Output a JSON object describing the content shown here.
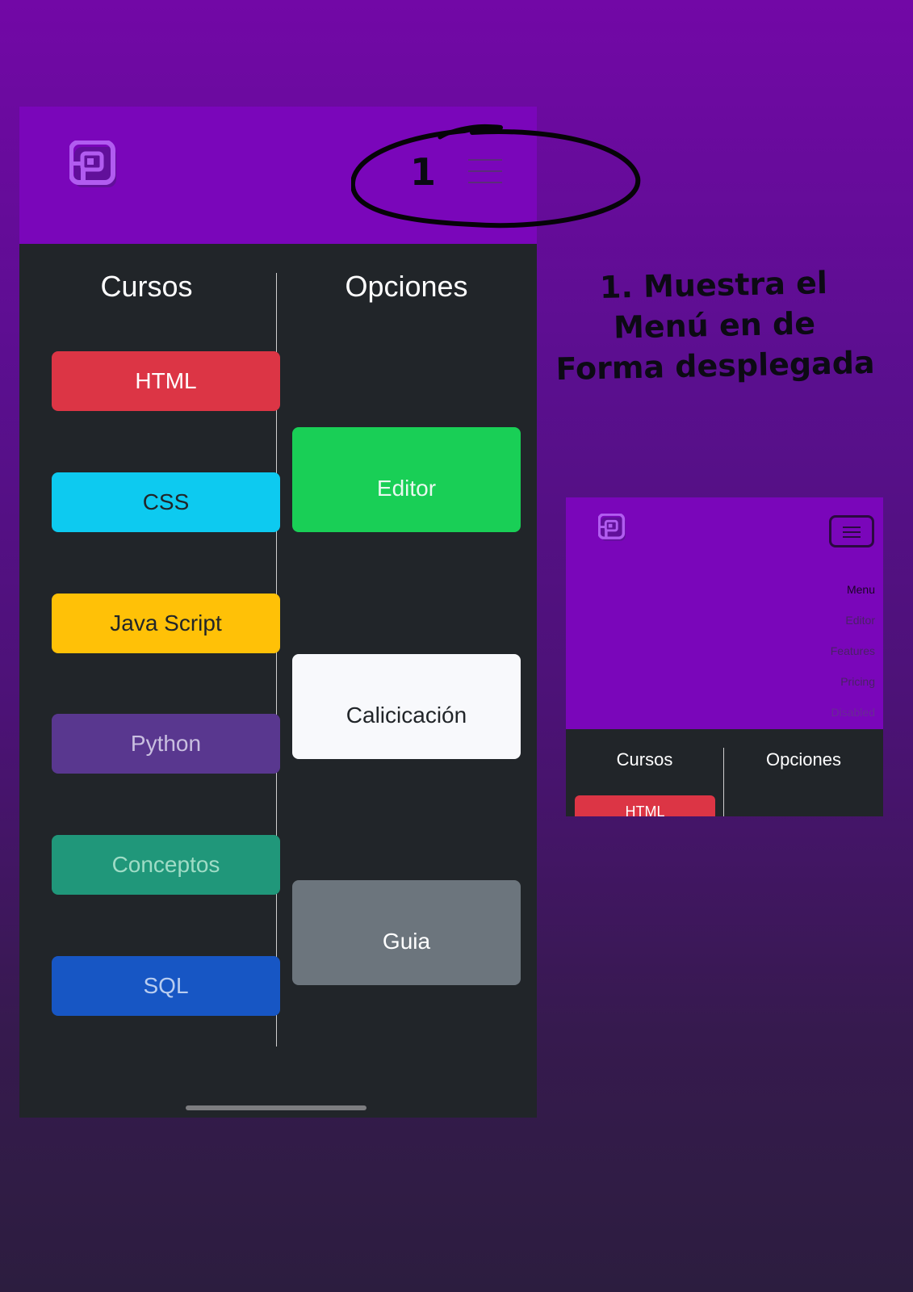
{
  "header": {
    "step_number": "1"
  },
  "main": {
    "courses_title": "Cursos",
    "options_title": "Opciones",
    "courses": [
      {
        "label": "HTML",
        "bg": "#dc3545",
        "fg": "#ffffff"
      },
      {
        "label": "CSS",
        "bg": "#0dcaf0",
        "fg": "#212529"
      },
      {
        "label": "Java Script",
        "bg": "#ffc107",
        "fg": "#212529"
      },
      {
        "label": "Python",
        "bg": "#59378f",
        "fg": "#c9bfe0"
      },
      {
        "label": "Conceptos",
        "bg": "#20977a",
        "fg": "#9fdcc6"
      },
      {
        "label": "SQL",
        "bg": "#1756c4",
        "fg": "#b9cdf0"
      }
    ],
    "options": [
      {
        "label": "Editor",
        "bg": "#19cf56",
        "fg": "#e9f8ef"
      },
      {
        "label": "Calicicación",
        "bg": "#f8f9fc",
        "fg": "#212529"
      },
      {
        "label": "Guia",
        "bg": "#6c757d",
        "fg": "#ffffff"
      }
    ]
  },
  "caption": {
    "line1": "1. Muestra el",
    "line2": "Menú en de",
    "line3": "Forma desplegada"
  },
  "preview": {
    "nav_items": [
      "Menu",
      "Editor",
      "Features",
      "Pricing",
      "Disabled"
    ],
    "courses_title": "Cursos",
    "options_title": "Opciones",
    "first_course": "HTML"
  },
  "colors": {
    "header_purple": "#7a06ba",
    "panel_dark": "#212529",
    "logo_purple": "#a14de0"
  },
  "icons": {
    "logo": "bootstrap-style-logo-icon",
    "menu": "hamburger-icon"
  }
}
